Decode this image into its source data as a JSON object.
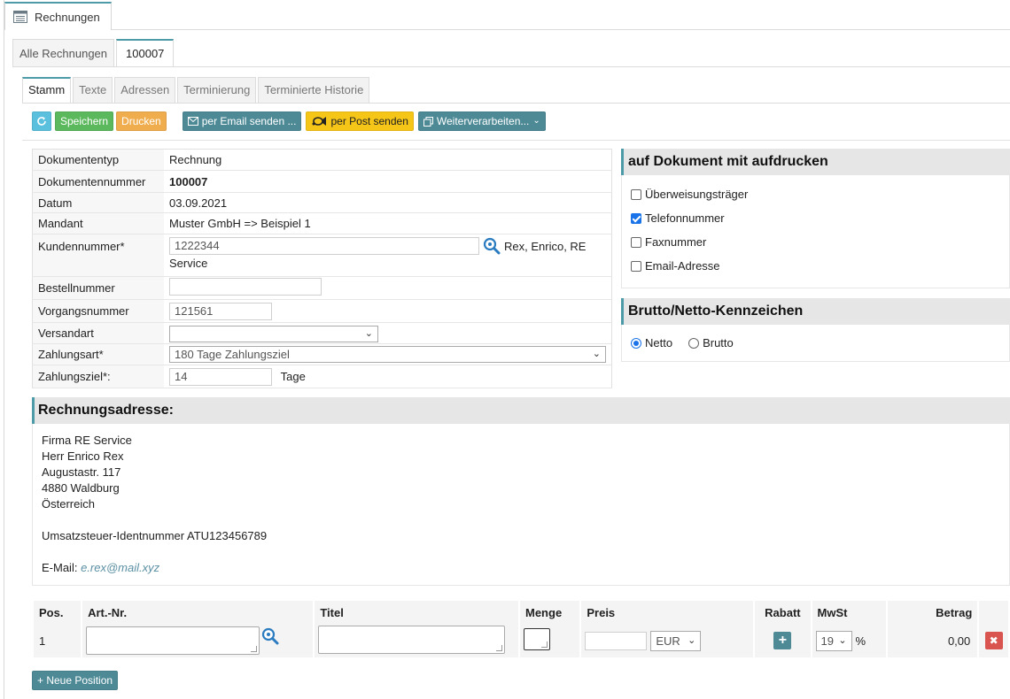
{
  "window_tab": {
    "title": "Rechnungen",
    "icon": "list-document-icon"
  },
  "tabs_level2": [
    {
      "label": "Alle Rechnungen",
      "active": false
    },
    {
      "label": "100007",
      "active": true
    }
  ],
  "tabs_level3": [
    {
      "label": "Stamm",
      "active": true
    },
    {
      "label": "Texte",
      "active": false
    },
    {
      "label": "Adressen",
      "active": false
    },
    {
      "label": "Terminierung",
      "active": false
    },
    {
      "label": "Terminierte Historie",
      "active": false
    }
  ],
  "toolbar": {
    "refresh_icon": "refresh-icon",
    "save": "Speichern",
    "print": "Drucken",
    "email": "per Email senden ...",
    "post": "per Post senden",
    "more": "Weiterverarbeiten..."
  },
  "form": {
    "doc_type_label": "Dokumententyp",
    "doc_type": "Rechnung",
    "doc_number_label": "Dokumentennummer",
    "doc_number": "100007",
    "date_label": "Datum",
    "date": "03.09.2021",
    "client_label": "Mandant",
    "client": "Muster GmbH => Beispiel 1",
    "customer_no_label": "Kundennummer*",
    "customer_no": "1222344",
    "customer_name_1": "Rex, Enrico, RE",
    "customer_name_2": "Service",
    "order_no_label": "Bestellnummer",
    "order_no": "",
    "process_no_label": "Vorgangsnummer",
    "process_no": "121561",
    "shipping_label": "Versandart",
    "shipping": "",
    "payment_type_label": "Zahlungsart*",
    "payment_type": "180 Tage Zahlungsziel",
    "payment_term_label": "Zahlungsziel*:",
    "payment_term": "14",
    "payment_term_unit": "Tage"
  },
  "print_options": {
    "title": "auf Dokument mit aufdrucken",
    "items": [
      {
        "label": "Überweisungsträger",
        "checked": false
      },
      {
        "label": "Telefonnummer",
        "checked": true
      },
      {
        "label": "Faxnummer",
        "checked": false
      },
      {
        "label": "Email-Adresse",
        "checked": false
      }
    ]
  },
  "gross_net": {
    "title": "Brutto/Netto-Kennzeichen",
    "options": [
      {
        "label": "Netto",
        "selected": true
      },
      {
        "label": "Brutto",
        "selected": false
      }
    ]
  },
  "address": {
    "title": "Rechnungsadresse:",
    "lines": [
      "Firma RE Service",
      "Herr Enrico Rex",
      "Augustastr. 117",
      "4880 Waldburg",
      "Österreich"
    ],
    "vat": "Umsatzsteuer-Identnummer ATU123456789",
    "email_label": "E-Mail:",
    "email": "e.rex@mail.xyz"
  },
  "positions": {
    "headers": {
      "pos": "Pos.",
      "art": "Art.-Nr.",
      "title": "Titel",
      "qty": "Menge",
      "price": "Preis",
      "discount": "Rabatt",
      "vat": "MwSt",
      "amount": "Betrag"
    },
    "rows": [
      {
        "pos": "1",
        "currency": "EUR",
        "vat": "19",
        "vat_unit": "%",
        "amount": "0,00"
      }
    ],
    "add_label": "+ Neue Position"
  },
  "colors": {
    "accent": "#4d9aa8",
    "teal_button": "#4d8a96",
    "success": "#5cb85c",
    "warning": "#f0ad4e",
    "info": "#5bc0de",
    "post_yellow": "#f5c518",
    "danger": "#d9534f"
  }
}
